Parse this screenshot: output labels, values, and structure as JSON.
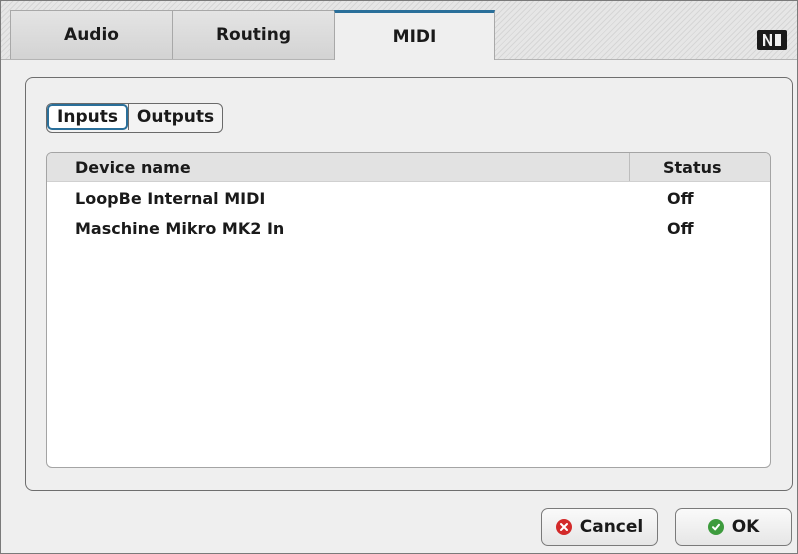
{
  "tabs": {
    "audio": "Audio",
    "routing": "Routing",
    "midi": "MIDI",
    "active": "MIDI"
  },
  "logo": "NI",
  "segment": {
    "inputs": "Inputs",
    "outputs": "Outputs",
    "selected": "Inputs"
  },
  "list": {
    "columns": {
      "name": "Device name",
      "status": "Status"
    },
    "rows": [
      {
        "name": "LoopBe Internal MIDI",
        "status": "Off"
      },
      {
        "name": "Maschine Mikro MK2 In",
        "status": "Off"
      }
    ]
  },
  "buttons": {
    "cancel": "Cancel",
    "ok": "OK"
  },
  "colors": {
    "accent": "#2a6f9a",
    "cancel_icon": "#d32a2a",
    "ok_icon": "#3d9b3d"
  }
}
